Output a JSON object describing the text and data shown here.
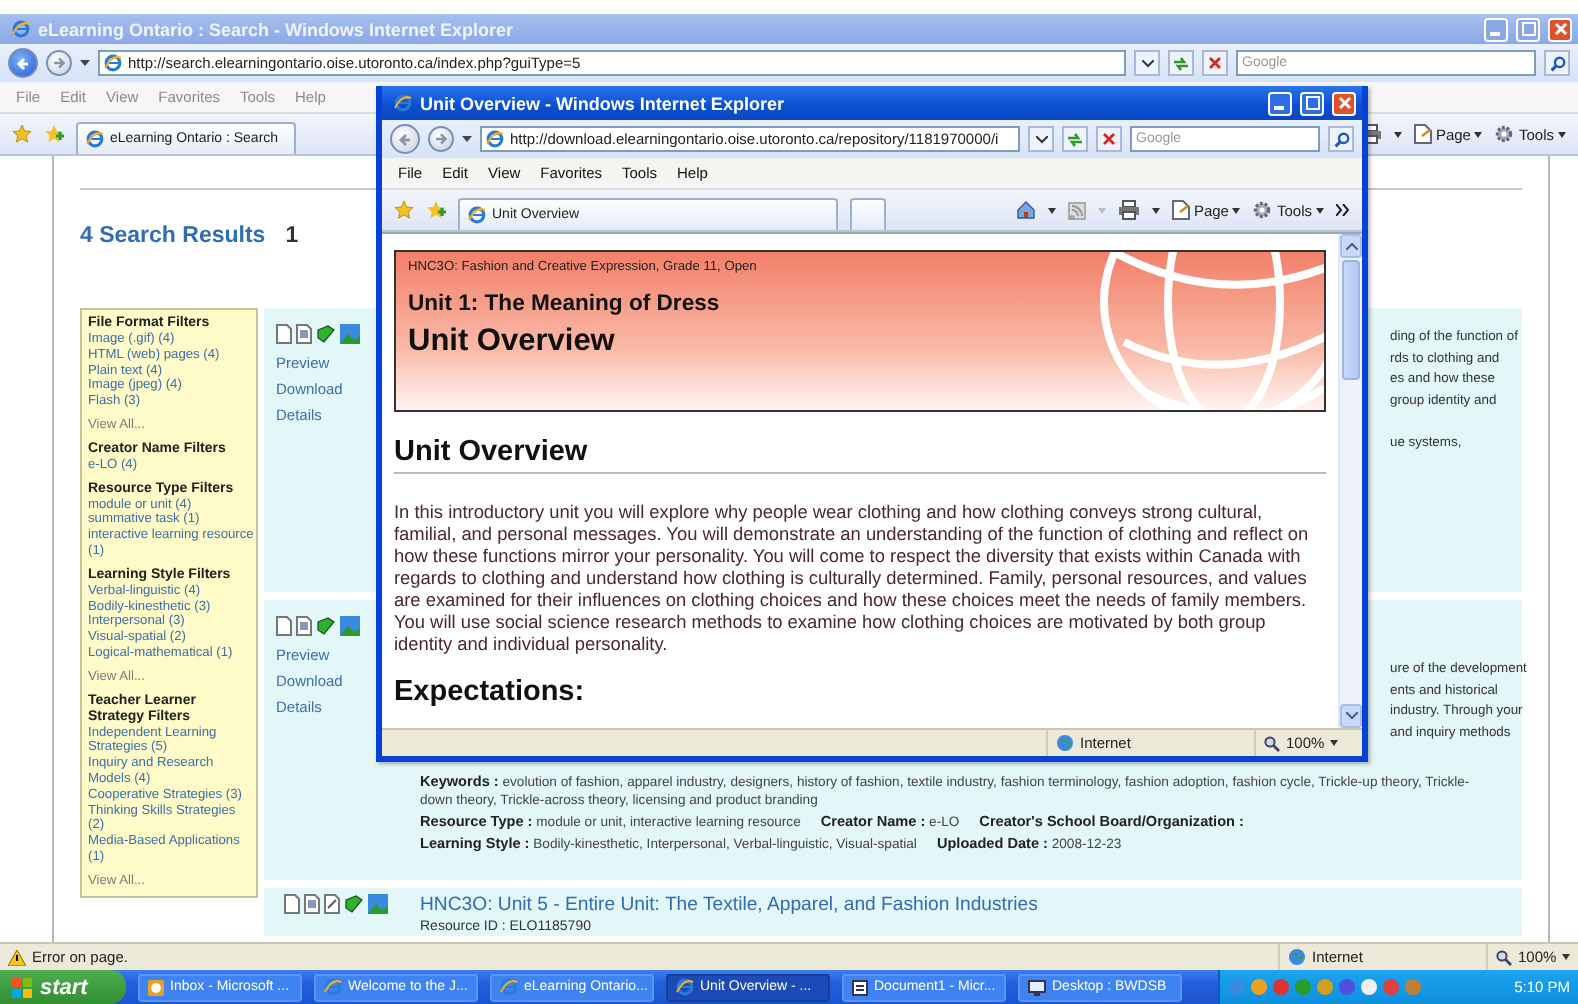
{
  "back_window": {
    "title": "eLearning Ontario : Search - Windows Internet Explorer",
    "address": "http://search.elearningontario.oise.utoronto.ca/index.php?guiType=5",
    "search_placeholder": "Google",
    "menu": [
      "File",
      "Edit",
      "View",
      "Favorites",
      "Tools",
      "Help"
    ],
    "tab": "eLearning Ontario : Search",
    "toolbar": [
      "Page",
      "Tools"
    ],
    "page": {
      "results_title": "4 Search Results",
      "page_number": "1",
      "filters": [
        {
          "heading": "File Format Filters",
          "items": [
            "Image (.gif) (4)",
            "HTML (web) pages (4)",
            "Plain text (4)",
            "Image (jpeg) (4)",
            "Flash (3)"
          ],
          "view_all": "View All..."
        },
        {
          "heading": "Creator Name Filters",
          "items": [
            "e-LO (4)"
          ]
        },
        {
          "heading": "Resource Type Filters",
          "items": [
            "module or unit (4)",
            "summative task (1)",
            "interactive learning resource (1)"
          ]
        },
        {
          "heading": "Learning Style Filters",
          "items": [
            "Verbal-linguistic (4)",
            "Bodily-kinesthetic (3)",
            "Interpersonal (3)",
            "Visual-spatial (2)",
            "Logical-mathematical (1)"
          ],
          "view_all": "View All..."
        },
        {
          "heading": "Teacher Learner Strategy Filters",
          "items": [
            "Independent Learning Strategies (5)",
            "Inquiry and Research Models (4)",
            "Cooperative Strategies (3)",
            "Thinking Skills Strategies (2)",
            "Media-Based Applications (1)"
          ],
          "view_all": "View All..."
        }
      ],
      "results": [
        {
          "actions": [
            "Preview",
            "Download",
            "Details"
          ],
          "snippet": [
            "ding of the function of",
            "rds to clothing and",
            "es and how these",
            "group identity and",
            "ue systems,"
          ]
        },
        {
          "actions": [
            "Preview",
            "Download",
            "Details"
          ],
          "snippet": [
            "ure of the development",
            "ents and historical",
            "industry. Through your",
            "and inquiry methods"
          ],
          "meta_lines": [
            [
              {
                "label": "Keywords :",
                "value": "evolution of fashion, apparel industry, designers, history of fashion, textile industry, fashion terminology, fashion adoption, fashion cycle, Trickle-up theory, Trickle-down theory, Trickle-across theory, licensing and product branding"
              }
            ],
            [
              {
                "label": "Resource Type :",
                "value": "module or unit, interactive learning resource"
              },
              {
                "label": "Creator Name :",
                "value": "e-LO"
              },
              {
                "label": "Creator's School Board/Organization :"
              }
            ],
            [
              {
                "label": "Learning Style :",
                "value": "Bodily-kinesthetic, Interpersonal, Verbal-linguistic, Visual-spatial"
              },
              {
                "label": "Uploaded Date :",
                "value": "2008-12-23"
              }
            ]
          ]
        },
        {
          "title": "HNC3O: Unit 5 - Entire Unit: The Textile, Apparel, and Fashion Industries",
          "resource_id": "Resource ID : ELO1185790"
        }
      ]
    },
    "status": {
      "text": "Error on page.",
      "zone": "Internet",
      "zoom": "100%"
    }
  },
  "front_window": {
    "title": "Unit Overview - Windows Internet Explorer",
    "address": "http://download.elearningontario.oise.utoronto.ca/repository/1181970000/i",
    "search_placeholder": "Google",
    "menu": [
      "File",
      "Edit",
      "View",
      "Favorites",
      "Tools",
      "Help"
    ],
    "tab": "Unit Overview",
    "toolbar": [
      "Page",
      "Tools"
    ],
    "page": {
      "course": "HNC3O: Fashion and Creative Expression, Grade 11, Open",
      "unit": "Unit 1: The Meaning of Dress",
      "banner_title": "Unit Overview",
      "heading": "Unit Overview",
      "paragraph": "In this introductory unit you will explore why people wear clothing and how clothing conveys strong cultural, familial, and personal messages. You will demonstrate an understanding of the function of clothing and reflect on how these functions mirror your personality. You will come to respect the diversity that exists within Canada with regards to clothing and understand how clothing is culturally determined. Family, personal resources, and values are examined for their influences on clothing choices and how these choices meet the needs of family members. You will use social science research methods to examine how clothing choices are motivated by both group identity and individual personality.",
      "next_heading": "Expectations:"
    },
    "status": {
      "zone": "Internet",
      "zoom": "100%"
    }
  },
  "taskbar": {
    "start": "start",
    "items": [
      {
        "label": "Inbox - Microsoft ...",
        "kind": "mail",
        "selected": false
      },
      {
        "label": "Welcome to the J...",
        "kind": "browser",
        "selected": false
      },
      {
        "label": "eLearning Ontario...",
        "kind": "browser",
        "selected": false
      },
      {
        "label": "Unit Overview - ...",
        "kind": "browser",
        "selected": true
      },
      {
        "label": "Document1 - Micr...",
        "kind": "document",
        "selected": false
      },
      {
        "label": "Desktop : BWDSB",
        "kind": "remote",
        "selected": false
      }
    ],
    "clock": "5:10 PM"
  }
}
